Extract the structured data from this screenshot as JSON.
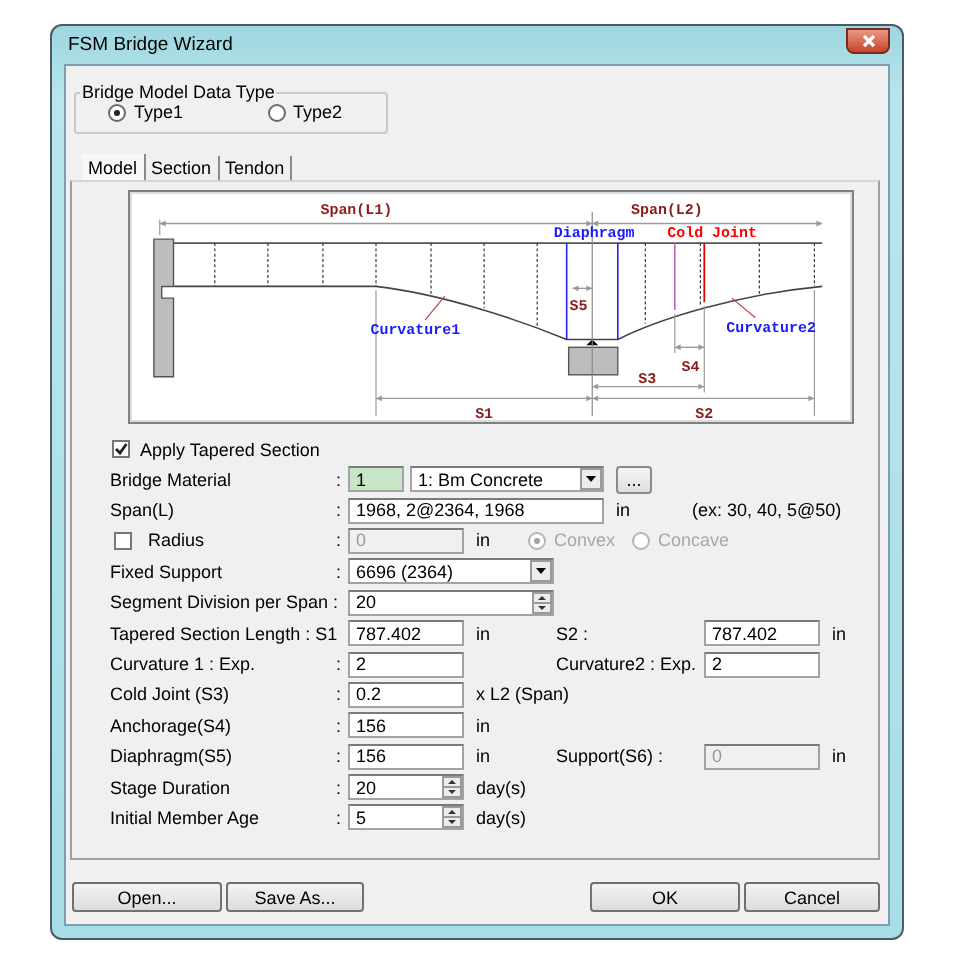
{
  "window": {
    "title": "FSM Bridge Wizard"
  },
  "data_type": {
    "title": "Bridge Model Data Type",
    "options": [
      {
        "label": "Type1",
        "selected": true
      },
      {
        "label": "Type2",
        "selected": false
      }
    ]
  },
  "tabs": [
    {
      "label": "Model",
      "selected": true
    },
    {
      "label": "Section",
      "selected": false
    },
    {
      "label": "Tendon",
      "selected": false
    }
  ],
  "diagram": {
    "labels": [
      {
        "text": "Span(L1)",
        "color": "#8b1c1c"
      },
      {
        "text": "Span(L2)",
        "color": "#8b1c1c"
      },
      {
        "text": "Diaphragm",
        "color": "#1a1aff"
      },
      {
        "text": "Cold Joint",
        "color": "#ff0000"
      },
      {
        "text": "S5",
        "color": "#8b1c1c"
      },
      {
        "text": "Curvature1",
        "color": "#1a1aff"
      },
      {
        "text": "Curvature2",
        "color": "#1a1aff"
      },
      {
        "text": "S4",
        "color": "#8b1c1c"
      },
      {
        "text": "S3",
        "color": "#8b1c1c"
      },
      {
        "text": "S1",
        "color": "#8b1c1c"
      },
      {
        "text": "S2",
        "color": "#8b1c1c"
      }
    ]
  },
  "apply_tapered": {
    "label": "Apply Tapered Section",
    "checked": true
  },
  "rows": [
    {
      "kind": "material",
      "label": "Bridge Material",
      "colon": ":",
      "id_value": "1",
      "value": "1: Bm Concrete",
      "button": "..."
    },
    {
      "kind": "longfield",
      "label": "Span(L)",
      "colon": ":",
      "value": "1968, 2@2364, 1968",
      "unit": "in",
      "hint": "(ex: 30, 40, 5@50)"
    },
    {
      "kind": "radius",
      "label": "Radius",
      "checked": false,
      "colon": ":",
      "value": "0",
      "disabled": true,
      "unit": "in",
      "options": [
        {
          "label": "Convex",
          "selected": true
        },
        {
          "label": "Concave",
          "selected": false
        }
      ]
    },
    {
      "kind": "combo",
      "label": "Fixed Support",
      "colon": ":",
      "value": "6696 (2364)"
    },
    {
      "kind": "longspin",
      "label": "Segment Division per Span :",
      "value": "20"
    },
    {
      "kind": "field",
      "label": "Tapered Section Length : S1",
      "value": "787.402",
      "unit": "in",
      "right": {
        "label": "S2 :",
        "value": "787.402",
        "unit": "in",
        "disabled": false
      }
    },
    {
      "kind": "field",
      "label": "Curvature 1 : Exp.",
      "colon": ":",
      "value": "2",
      "right": {
        "label": "Curvature2 : Exp.",
        "value": "2",
        "disabled": false
      }
    },
    {
      "kind": "field",
      "label": "Cold Joint (S3)",
      "colon": ":",
      "value": "0.2",
      "unit": "x L2 (Span)"
    },
    {
      "kind": "field",
      "label": "Anchorage(S4)",
      "colon": ":",
      "value": "156",
      "unit": "in"
    },
    {
      "kind": "field",
      "label": "Diaphragm(S5)",
      "colon": ":",
      "value": "156",
      "unit": "in",
      "right": {
        "label": "Support(S6) :",
        "value": "0",
        "unit": "in",
        "disabled": true
      }
    },
    {
      "kind": "spin",
      "label": "Stage Duration",
      "colon": ":",
      "value": "20",
      "unit": "day(s)"
    },
    {
      "kind": "spin",
      "label": "Initial Member Age",
      "colon": ":",
      "value": "5",
      "unit": "day(s)"
    }
  ],
  "left_buttons": [
    "Open...",
    "Save As..."
  ],
  "right_buttons": [
    "OK",
    "Cancel"
  ]
}
